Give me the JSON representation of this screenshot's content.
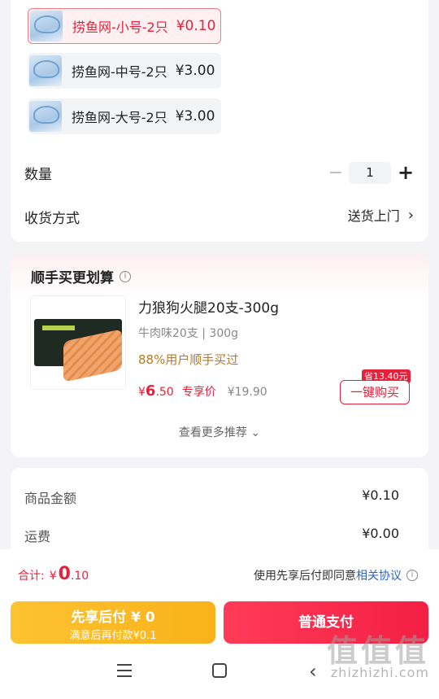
{
  "skus": [
    {
      "name": "捞鱼网-小号-2只",
      "price": "¥0.10",
      "selected": true
    },
    {
      "name": "捞鱼网-中号-2只",
      "price": "¥3.00",
      "selected": false
    },
    {
      "name": "捞鱼网-大号-2只",
      "price": "¥3.00",
      "selected": false
    }
  ],
  "quantity": {
    "label": "数量",
    "value": "1",
    "minus": "−",
    "plus": "+"
  },
  "delivery": {
    "label": "收货方式",
    "value": "送货上门",
    "chevron": "›"
  },
  "recommend": {
    "title": "顺手买更划算",
    "info": "i",
    "product": {
      "title": "力狼狗火腿20支-300g",
      "spec": "牛肉味20支 | 300g",
      "buyers": "88%用户顺手买过",
      "price_symbol": "¥",
      "price_int": "6",
      "price_dec": ".50",
      "price_tag": "专享价",
      "orig_price": "¥19.90",
      "save_badge": "省13.40元",
      "buy_label": "一键购买"
    },
    "more": "查看更多推荐 ⌄"
  },
  "summary": {
    "goods_label": "商品金额",
    "goods_value": "¥0.10",
    "freight_label": "运费",
    "freight_value": "¥0.00"
  },
  "bottom": {
    "total_label": "合计:",
    "total_symbol": "¥",
    "total_int": "0",
    "total_dec": ".10",
    "agree_text": "使用先享后付即同意",
    "agree_link": "相关协议",
    "later_line1": "先享后付 ¥ 0",
    "later_line2": "满意后再付款¥0.1",
    "pay_label": "普通支付"
  },
  "nav": {
    "back": "‹"
  },
  "watermark": {
    "text": "值值值",
    "url": "zhizhizhi.com"
  },
  "colors": {
    "accent": "#e8213b",
    "later": "#fdc231",
    "link": "#2a63c8"
  }
}
